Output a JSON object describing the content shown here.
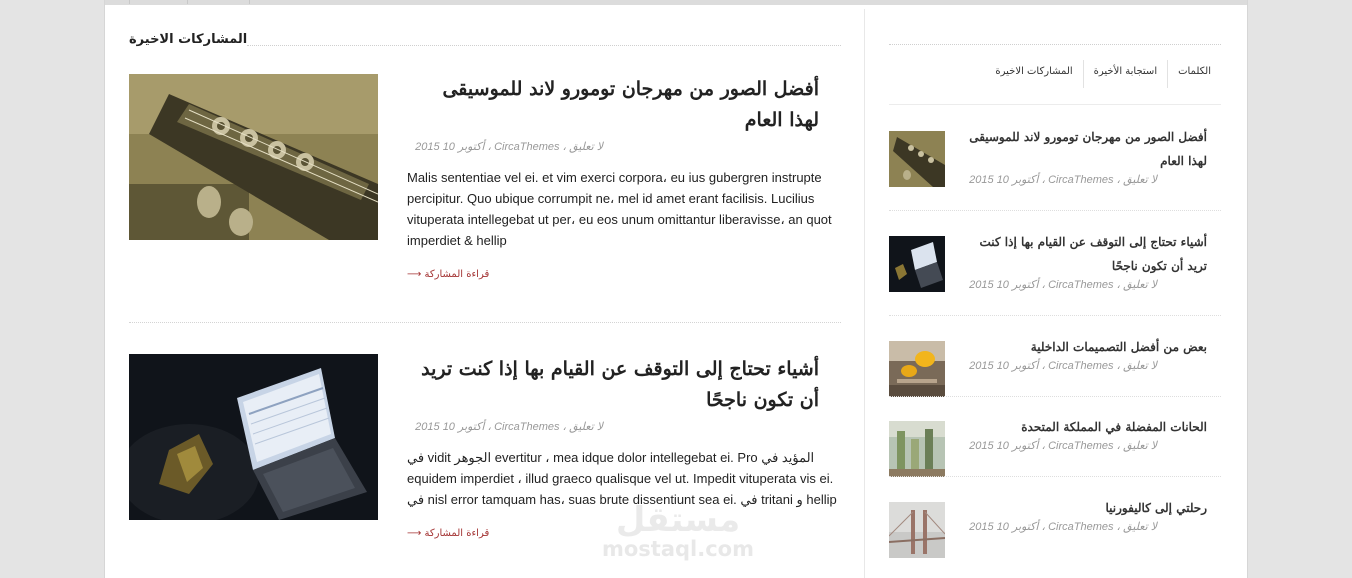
{
  "main": {
    "section_title": "المشاركات الاخيرة",
    "posts": [
      {
        "title": "أفضل الصور من مهرجان تومورو لاند للموسيقى لهذا العام",
        "meta": "لا تعليق ، CircaThemes ، أكتوبر 10 2015",
        "excerpt": "Malis sententiae vel ei. et vim exerci corpora، eu ius gubergren instrupte percipitur. Quo ubique corrumpit ne، mel id amet erant facilisis. Lucilius vituperata intellegebat ut per، eu eos unum omittantur liberavisse، an quot imperdiet & hellip",
        "read_more": "قراءة المشاركة ⟶"
      },
      {
        "title": "أشياء تحتاج إلى التوقف عن القيام بها إذا كنت تريد أن تكون ناجحًا",
        "meta": "لا تعليق ، CircaThemes ، أكتوبر 10 2015",
        "excerpt": "في vidit الجوهر evertitur ، mea idque dolor intellegebat ei. Pro المؤيد في equidem imperdiet ، illud graeco qualisque vel ut. Impedit vituperata vis ei. في nisl error tamquam has، suas brute dissentiunt sea ei. في tritani و hellip",
        "read_more": "قراءة المشاركة ⟶"
      }
    ]
  },
  "sidebar": {
    "tabs": [
      "الكلمات",
      "استجابة الأخيرة",
      "المشاركات الاخيرة"
    ],
    "items": [
      {
        "title": "أفضل الصور من مهرجان تومورو لاند للموسيقى لهذا العام",
        "meta": "لا تعليق ، CircaThemes ، أكتوبر 10 2015",
        "thumb": "guitar"
      },
      {
        "title": "أشياء تحتاج إلى التوقف عن القيام بها إذا كنت تريد أن تكون ناجحًا",
        "meta": "لا تعليق ، CircaThemes ، أكتوبر 10 2015",
        "thumb": "laptop"
      },
      {
        "title": "بعض من أفضل التصميمات الداخلية",
        "meta": "لا تعليق ، CircaThemes ، أكتوبر 10 2015",
        "thumb": "chairs"
      },
      {
        "title": "الحانات المفضلة في المملكة المتحدة",
        "meta": "لا تعليق ، CircaThemes ، أكتوبر 10 2015",
        "thumb": "bottles"
      },
      {
        "title": "رحلتي إلى كاليفورنيا",
        "meta": "لا تعليق ، CircaThemes ، أكتوبر 10 2015",
        "thumb": "bridge"
      }
    ]
  },
  "watermark": {
    "arabic": "مستقل",
    "latin": "mostaql.com"
  },
  "colors": {
    "read_more": "#a33232",
    "meta": "#999999",
    "page_bg": "#e4e4e4"
  }
}
